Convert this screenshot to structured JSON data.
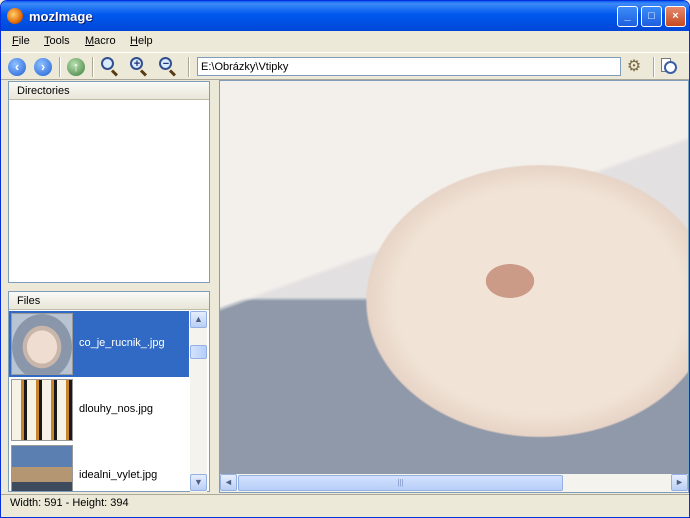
{
  "window": {
    "title": "mozImage"
  },
  "title_buttons": {
    "minimize": "_",
    "maximize": "□",
    "close": "×"
  },
  "menu": [
    "File",
    "Tools",
    "Macro",
    "Help"
  ],
  "toolbar": {
    "back_glyph": "‹",
    "forward_glyph": "›",
    "up_glyph": "↑",
    "zoom_fit_glyph": "",
    "zoom_in_glyph": "+",
    "zoom_out_glyph": "−",
    "path_value": "E:\\Obrázky\\Vtipky",
    "settings_glyph": "⚙"
  },
  "directories": {
    "header": "Directories"
  },
  "files": {
    "header": "Files",
    "items": [
      {
        "name": "co_je_rucnik_.jpg",
        "selected": true,
        "thumb": "dog"
      },
      {
        "name": "dlouhy_nos.jpg",
        "selected": false,
        "thumb": "dalmatian"
      },
      {
        "name": "idealni_vylet.jpg",
        "selected": false,
        "thumb": "trip"
      }
    ]
  },
  "scroll": {
    "up": "▲",
    "down": "▼",
    "left": "◄",
    "right": "►",
    "grip": "|||"
  },
  "status": {
    "text": "Width: 591 - Height: 394"
  },
  "colors": {
    "titlebar": "#0054e3",
    "selection": "#316ac5",
    "chrome": "#ece9d8"
  },
  "icons": [
    "firefox-app-icon",
    "back-icon",
    "forward-icon",
    "up-icon",
    "zoom-fit-icon",
    "zoom-in-icon",
    "zoom-out-icon",
    "settings-gear-icon",
    "slideshow-clock-icon"
  ]
}
